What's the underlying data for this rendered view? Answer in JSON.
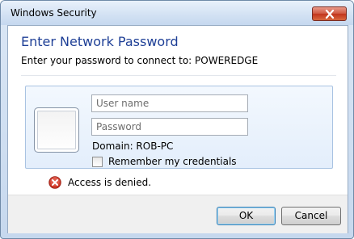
{
  "window": {
    "title": "Windows Security"
  },
  "dialog": {
    "main_instruction": "Enter Network Password",
    "sub_text": "Enter your password to connect to: POWEREDGE",
    "username_placeholder": "User name",
    "username_value": "",
    "password_placeholder": "Password",
    "password_value": "",
    "domain_text": "Domain: ROB-PC",
    "remember_label": "Remember my credentials",
    "remember_checked": false,
    "error_text": "Access is denied."
  },
  "buttons": {
    "ok_label": "OK",
    "cancel_label": "Cancel"
  },
  "colors": {
    "title_blue": "#1e3f96",
    "error_red": "#c0392b",
    "close_red": "#c2341c"
  },
  "icons": {
    "close": "close-icon",
    "error": "error-x-icon",
    "avatar": "user-tile"
  }
}
